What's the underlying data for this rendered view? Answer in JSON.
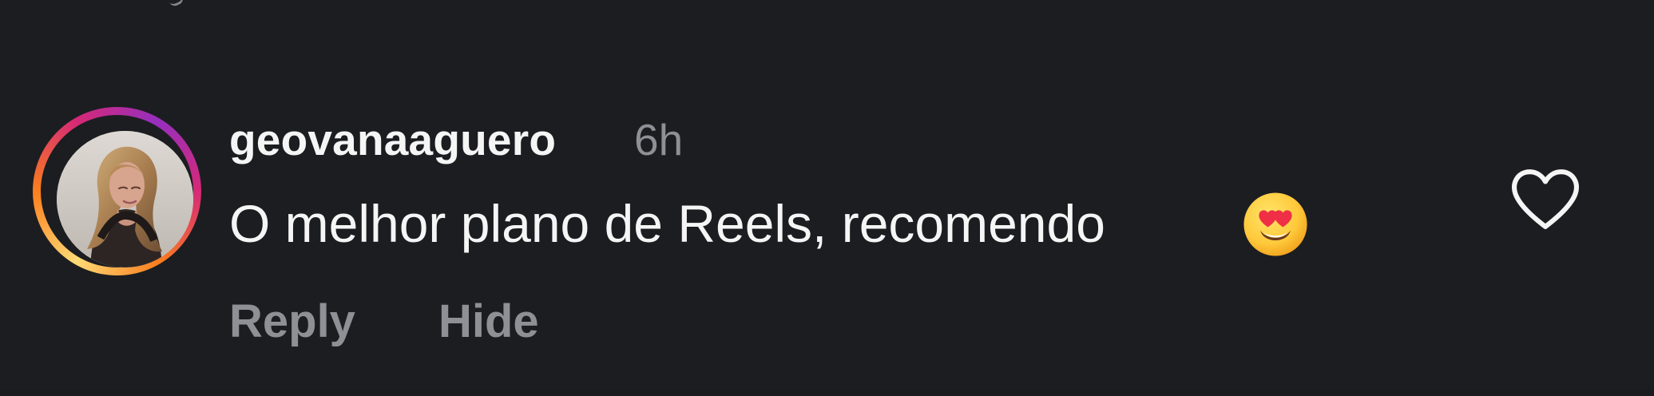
{
  "comment": {
    "username": "geovanaaguero",
    "time": "6h",
    "text": "O melhor plano de Reels, recomendo",
    "emoji_name": "smiling-face-with-heart-eyes-icon",
    "actions": {
      "reply_label": "Reply",
      "hide_label": "Hide"
    }
  },
  "colors": {
    "background": "#1c1d21",
    "primary_text": "#f5f5f5",
    "secondary_text": "#8e9096",
    "story_ring_start": "#feda75",
    "story_ring_mid": "#d62976",
    "story_ring_end": "#962fbf",
    "heart_stroke": "#f5f5f5"
  },
  "icons": {
    "like": "heart-outline-icon"
  }
}
